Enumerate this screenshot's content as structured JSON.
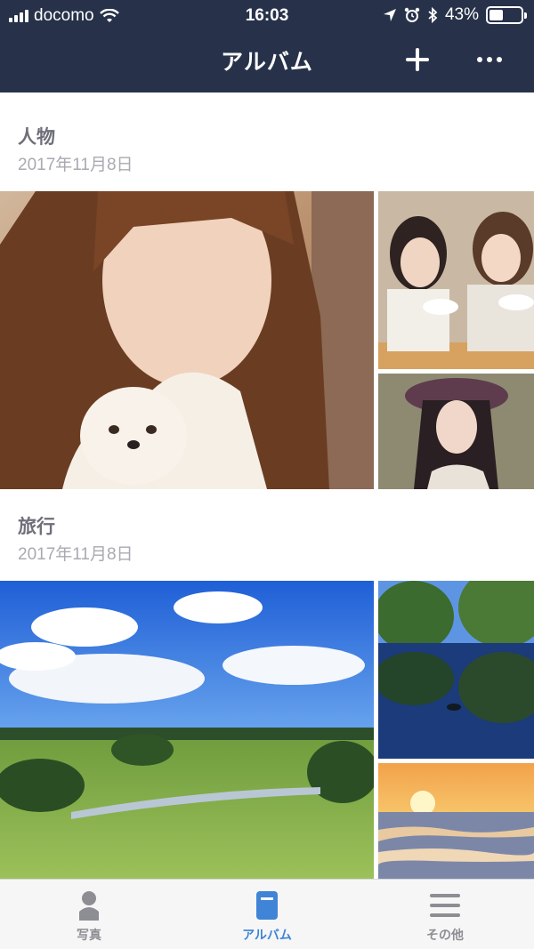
{
  "status_bar": {
    "carrier": "docomo",
    "time": "16:03",
    "battery": "43%",
    "battery_level": 0.43
  },
  "nav": {
    "title": "アルバム",
    "add_icon": "plus-icon",
    "more_icon": "more-icon"
  },
  "albums": [
    {
      "title": "人物",
      "date": "2017年11月8日",
      "photos": [
        "portrait-girl-with-dog",
        "two-girls-eating",
        "girl-with-hat"
      ]
    },
    {
      "title": "旅行",
      "date": "2017年11月8日",
      "photos": [
        "blue-sky-meadow",
        "pond-reflection",
        "sunset-sea"
      ]
    }
  ],
  "tabs": [
    {
      "label": "写真",
      "icon": "person-icon",
      "active": false
    },
    {
      "label": "アルバム",
      "icon": "album-icon",
      "active": true
    },
    {
      "label": "その他",
      "icon": "menu-icon",
      "active": false
    }
  ],
  "colors": {
    "header": "#27324a",
    "accent": "#3f84d6",
    "tab_inactive": "#8d8e93"
  }
}
